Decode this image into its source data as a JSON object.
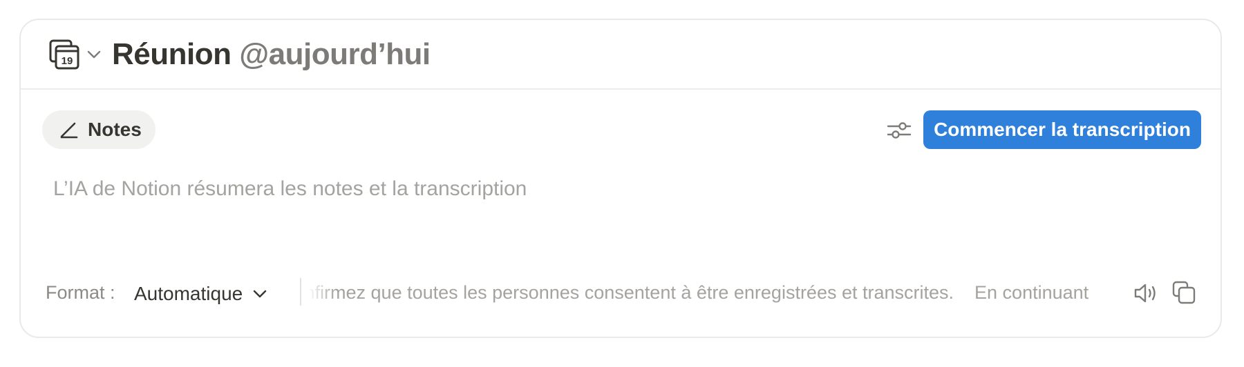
{
  "header": {
    "calendar_icon": "calendar-19-icon",
    "calendar_day": "19",
    "title": "Réunion",
    "mention": "@aujourd’hui"
  },
  "toolbar": {
    "notes_tab_label": "Notes",
    "notes_icon": "pencil-icon",
    "settings_icon": "sliders-icon",
    "start_transcription_label": "Commencer la transcription",
    "accent_color": "#2f80db"
  },
  "editor": {
    "placeholder": "L’IA de Notion résumera les notes et la transcription"
  },
  "footer": {
    "format_label": "Format :",
    "format_value": "Automatique",
    "consent_text": "Confirmez que toutes les personnes consentent à être enregistrées et transcrites.    En continuant",
    "speaker_icon": "speaker-icon",
    "copy_icon": "copy-icon"
  }
}
